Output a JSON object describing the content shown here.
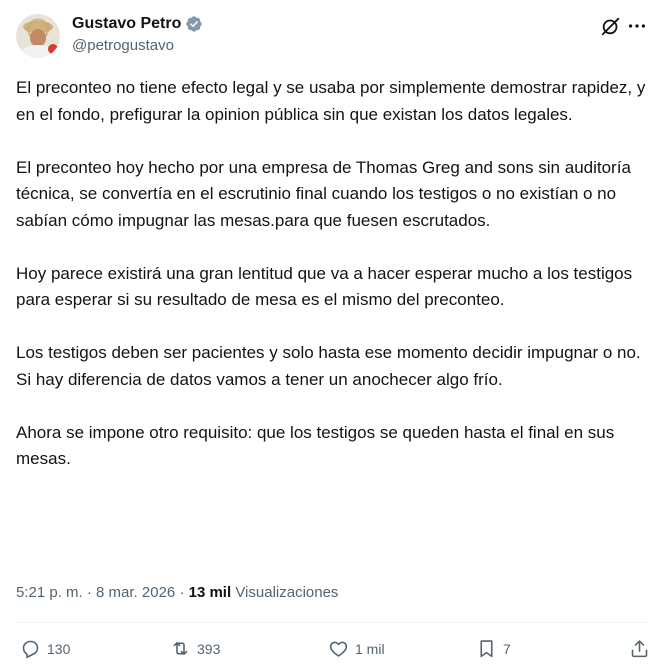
{
  "author": {
    "display_name": "Gustavo Petro",
    "handle": "@petrogustavo",
    "verified": true
  },
  "tweet": {
    "text": "El preconteo no tiene efecto legal y se usaba por simplemente demostrar rapidez, y en el fondo, prefigurar la opinion pública sin que existan los datos legales.\n\nEl preconteo hoy hecho por una empresa de Thomas Greg and sons sin auditoría técnica, se convertía en el escrutinio final cuando los testigos o no existían o no sabían cómo impugnar las mesas.para que fuesen escrutados.\n\nHoy parece existirá una gran lentitud que va a hacer esperar mucho a los testigos para esperar si su resultado de mesa es el mismo del preconteo.\n\nLos testigos deben ser pacientes y solo hasta ese momento decidir impugnar o no. Si hay diferencia de datos vamos a tener un anochecer algo frío.\n\nAhora se impone otro requisito: que los testigos se queden hasta el final en sus mesas."
  },
  "meta": {
    "time": "5:21 p. m.",
    "separator": "·",
    "date": "8 mar. 2026",
    "views_count": "13 mil",
    "views_label": "Visualizaciones"
  },
  "actions": {
    "replies": "130",
    "reposts": "393",
    "likes": "1 mil",
    "bookmarks": "7"
  },
  "icons": [
    "verified-badge-icon",
    "grok-icon",
    "more-icon",
    "reply-icon",
    "repost-icon",
    "like-icon",
    "bookmark-icon",
    "share-icon"
  ],
  "colors": {
    "text": "#0f1419",
    "secondary": "#536471",
    "verified": "#829aab",
    "divider": "#eff3f4"
  }
}
